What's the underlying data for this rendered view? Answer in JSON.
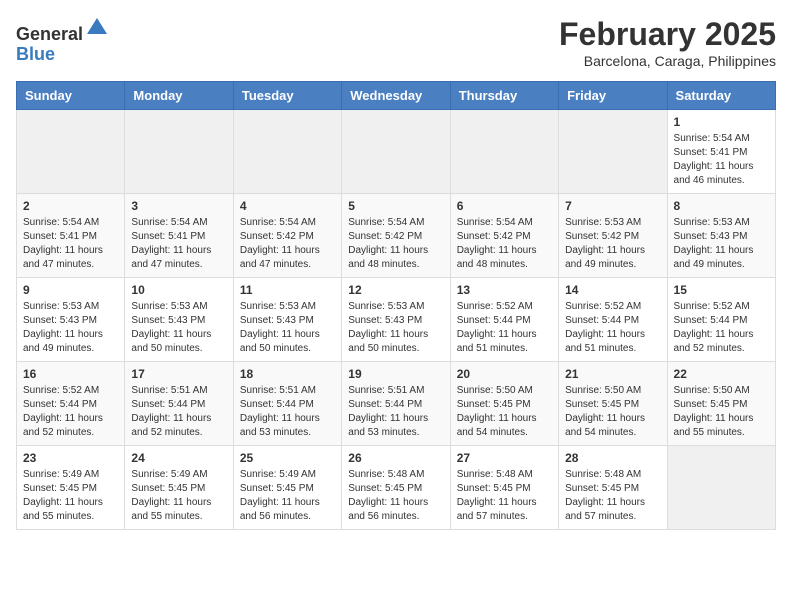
{
  "header": {
    "logo_general": "General",
    "logo_blue": "Blue",
    "month_year": "February 2025",
    "location": "Barcelona, Caraga, Philippines"
  },
  "weekdays": [
    "Sunday",
    "Monday",
    "Tuesday",
    "Wednesday",
    "Thursday",
    "Friday",
    "Saturday"
  ],
  "weeks": [
    [
      {
        "day": "",
        "info": ""
      },
      {
        "day": "",
        "info": ""
      },
      {
        "day": "",
        "info": ""
      },
      {
        "day": "",
        "info": ""
      },
      {
        "day": "",
        "info": ""
      },
      {
        "day": "",
        "info": ""
      },
      {
        "day": "1",
        "info": "Sunrise: 5:54 AM\nSunset: 5:41 PM\nDaylight: 11 hours\nand 46 minutes."
      }
    ],
    [
      {
        "day": "2",
        "info": "Sunrise: 5:54 AM\nSunset: 5:41 PM\nDaylight: 11 hours\nand 47 minutes."
      },
      {
        "day": "3",
        "info": "Sunrise: 5:54 AM\nSunset: 5:41 PM\nDaylight: 11 hours\nand 47 minutes."
      },
      {
        "day": "4",
        "info": "Sunrise: 5:54 AM\nSunset: 5:42 PM\nDaylight: 11 hours\nand 47 minutes."
      },
      {
        "day": "5",
        "info": "Sunrise: 5:54 AM\nSunset: 5:42 PM\nDaylight: 11 hours\nand 48 minutes."
      },
      {
        "day": "6",
        "info": "Sunrise: 5:54 AM\nSunset: 5:42 PM\nDaylight: 11 hours\nand 48 minutes."
      },
      {
        "day": "7",
        "info": "Sunrise: 5:53 AM\nSunset: 5:42 PM\nDaylight: 11 hours\nand 49 minutes."
      },
      {
        "day": "8",
        "info": "Sunrise: 5:53 AM\nSunset: 5:43 PM\nDaylight: 11 hours\nand 49 minutes."
      }
    ],
    [
      {
        "day": "9",
        "info": "Sunrise: 5:53 AM\nSunset: 5:43 PM\nDaylight: 11 hours\nand 49 minutes."
      },
      {
        "day": "10",
        "info": "Sunrise: 5:53 AM\nSunset: 5:43 PM\nDaylight: 11 hours\nand 50 minutes."
      },
      {
        "day": "11",
        "info": "Sunrise: 5:53 AM\nSunset: 5:43 PM\nDaylight: 11 hours\nand 50 minutes."
      },
      {
        "day": "12",
        "info": "Sunrise: 5:53 AM\nSunset: 5:43 PM\nDaylight: 11 hours\nand 50 minutes."
      },
      {
        "day": "13",
        "info": "Sunrise: 5:52 AM\nSunset: 5:44 PM\nDaylight: 11 hours\nand 51 minutes."
      },
      {
        "day": "14",
        "info": "Sunrise: 5:52 AM\nSunset: 5:44 PM\nDaylight: 11 hours\nand 51 minutes."
      },
      {
        "day": "15",
        "info": "Sunrise: 5:52 AM\nSunset: 5:44 PM\nDaylight: 11 hours\nand 52 minutes."
      }
    ],
    [
      {
        "day": "16",
        "info": "Sunrise: 5:52 AM\nSunset: 5:44 PM\nDaylight: 11 hours\nand 52 minutes."
      },
      {
        "day": "17",
        "info": "Sunrise: 5:51 AM\nSunset: 5:44 PM\nDaylight: 11 hours\nand 52 minutes."
      },
      {
        "day": "18",
        "info": "Sunrise: 5:51 AM\nSunset: 5:44 PM\nDaylight: 11 hours\nand 53 minutes."
      },
      {
        "day": "19",
        "info": "Sunrise: 5:51 AM\nSunset: 5:44 PM\nDaylight: 11 hours\nand 53 minutes."
      },
      {
        "day": "20",
        "info": "Sunrise: 5:50 AM\nSunset: 5:45 PM\nDaylight: 11 hours\nand 54 minutes."
      },
      {
        "day": "21",
        "info": "Sunrise: 5:50 AM\nSunset: 5:45 PM\nDaylight: 11 hours\nand 54 minutes."
      },
      {
        "day": "22",
        "info": "Sunrise: 5:50 AM\nSunset: 5:45 PM\nDaylight: 11 hours\nand 55 minutes."
      }
    ],
    [
      {
        "day": "23",
        "info": "Sunrise: 5:49 AM\nSunset: 5:45 PM\nDaylight: 11 hours\nand 55 minutes."
      },
      {
        "day": "24",
        "info": "Sunrise: 5:49 AM\nSunset: 5:45 PM\nDaylight: 11 hours\nand 55 minutes."
      },
      {
        "day": "25",
        "info": "Sunrise: 5:49 AM\nSunset: 5:45 PM\nDaylight: 11 hours\nand 56 minutes."
      },
      {
        "day": "26",
        "info": "Sunrise: 5:48 AM\nSunset: 5:45 PM\nDaylight: 11 hours\nand 56 minutes."
      },
      {
        "day": "27",
        "info": "Sunrise: 5:48 AM\nSunset: 5:45 PM\nDaylight: 11 hours\nand 57 minutes."
      },
      {
        "day": "28",
        "info": "Sunrise: 5:48 AM\nSunset: 5:45 PM\nDaylight: 11 hours\nand 57 minutes."
      },
      {
        "day": "",
        "info": ""
      }
    ]
  ]
}
